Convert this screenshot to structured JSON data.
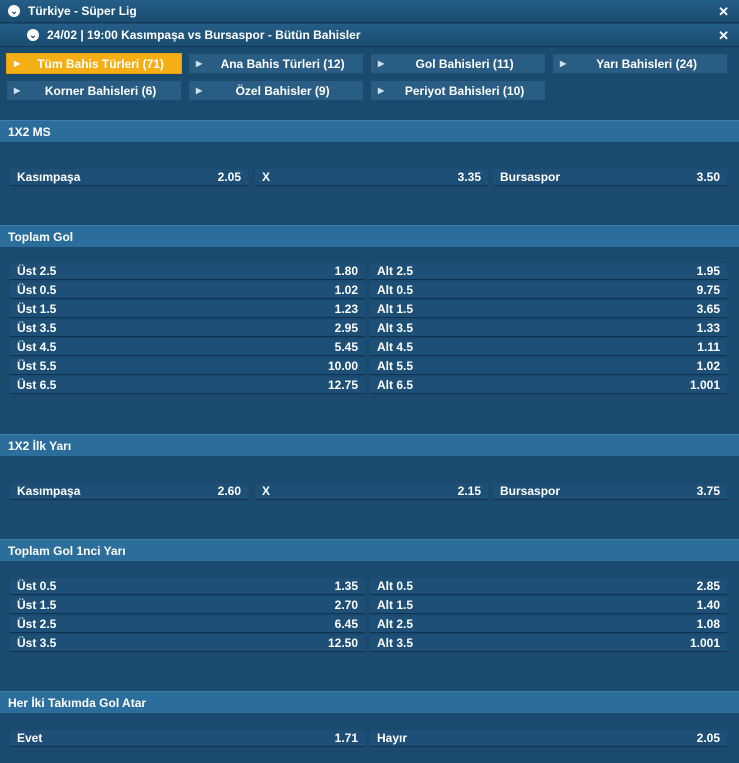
{
  "league": {
    "title": "Türkiye - Süper Lig"
  },
  "match": {
    "title": "24/02 | 19:00 Kasımpaşa vs Bursaspor - Bütün Bahisler"
  },
  "tabs": [
    "Tüm Bahis Türleri (71)",
    "Ana Bahis Türleri (12)",
    "Gol Bahisleri (11)",
    "Yarı Bahisleri (24)",
    "Korner Bahisleri (6)",
    "Özel Bahisler (9)",
    "Periyot Bahisleri (10)"
  ],
  "sections": {
    "ms": {
      "title": "1X2 MS",
      "row": [
        {
          "label": "Kasımpaşa",
          "odd": "2.05"
        },
        {
          "label": "X",
          "odd": "3.35"
        },
        {
          "label": "Bursaspor",
          "odd": "3.50"
        }
      ]
    },
    "toplam_gol": {
      "title": "Toplam Gol",
      "rows": [
        [
          {
            "label": "Üst 2.5",
            "odd": "1.80"
          },
          {
            "label": "Alt 2.5",
            "odd": "1.95"
          }
        ],
        [
          {
            "label": "Üst 0.5",
            "odd": "1.02"
          },
          {
            "label": "Alt 0.5",
            "odd": "9.75"
          }
        ],
        [
          {
            "label": "Üst 1.5",
            "odd": "1.23"
          },
          {
            "label": "Alt 1.5",
            "odd": "3.65"
          }
        ],
        [
          {
            "label": "Üst 3.5",
            "odd": "2.95"
          },
          {
            "label": "Alt 3.5",
            "odd": "1.33"
          }
        ],
        [
          {
            "label": "Üst 4.5",
            "odd": "5.45"
          },
          {
            "label": "Alt 4.5",
            "odd": "1.11"
          }
        ],
        [
          {
            "label": "Üst 5.5",
            "odd": "10.00"
          },
          {
            "label": "Alt 5.5",
            "odd": "1.02"
          }
        ],
        [
          {
            "label": "Üst 6.5",
            "odd": "12.75"
          },
          {
            "label": "Alt 6.5",
            "odd": "1.001"
          }
        ]
      ]
    },
    "ilk_yari": {
      "title": "1X2 İlk Yarı",
      "row": [
        {
          "label": "Kasımpaşa",
          "odd": "2.60"
        },
        {
          "label": "X",
          "odd": "2.15"
        },
        {
          "label": "Bursaspor",
          "odd": "3.75"
        }
      ]
    },
    "toplam_gol_1": {
      "title": "Toplam Gol 1nci Yarı",
      "rows": [
        [
          {
            "label": "Üst 0.5",
            "odd": "1.35"
          },
          {
            "label": "Alt 0.5",
            "odd": "2.85"
          }
        ],
        [
          {
            "label": "Üst 1.5",
            "odd": "2.70"
          },
          {
            "label": "Alt 1.5",
            "odd": "1.40"
          }
        ],
        [
          {
            "label": "Üst 2.5",
            "odd": "6.45"
          },
          {
            "label": "Alt 2.5",
            "odd": "1.08"
          }
        ],
        [
          {
            "label": "Üst 3.5",
            "odd": "12.50"
          },
          {
            "label": "Alt 3.5",
            "odd": "1.001"
          }
        ]
      ]
    },
    "kg": {
      "title": "Her İki Takımda Gol Atar",
      "row": [
        {
          "label": "Evet",
          "odd": "1.71"
        },
        {
          "label": "Hayır",
          "odd": "2.05"
        }
      ]
    }
  }
}
